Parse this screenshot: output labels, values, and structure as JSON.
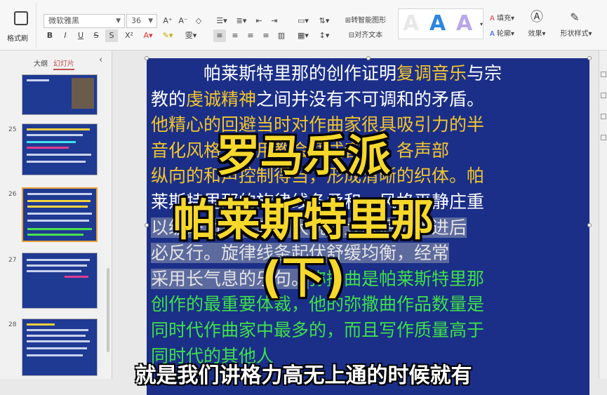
{
  "ribbon": {
    "format_painter_label": "格式刷",
    "font_name": "微软雅黑",
    "font_size": "36",
    "bold": "B",
    "italic": "I",
    "underline": "U",
    "strikethrough": "S",
    "shadow": "S",
    "superscript": "X²",
    "convert_smartart": "转智能图形",
    "text_direction": "文字方向",
    "align_text": "对齐文本",
    "fill": "填充",
    "outline": "轮廓",
    "effects": "效果",
    "shape_style": "形状样式",
    "wordart_letter": "A"
  },
  "panel": {
    "tab_outline": "大纲",
    "tab_slides": "幻灯片",
    "slide_numbers": [
      "25",
      "26",
      "27",
      "28"
    ]
  },
  "slide": {
    "line1_a": "帕莱斯特里那的创作证明",
    "line1_b": "复调音乐",
    "line1_c": "与宗",
    "line2_a": "教的",
    "line2_b": "虔诚精神",
    "line2_c": "之间并没有不可调和的矛盾。",
    "line3": "他精心的回避当时对作曲家很具吸引力的半",
    "line4": "音化风格，采用教会调式音阶，各声部",
    "line5": "纵向的和声控制得当，形成清晰的织体。帕",
    "line6": "莱斯特里那的旋律线条柔和，风格平静庄重",
    "line7": "以级进为主，较少大跳，大跳后的跳进后",
    "line8": "必反行。旋律线条起伏舒缓均衡，经常",
    "line9_a": "采用长气息的乐句。",
    "line9_b": "弥撒曲是帕莱斯特里那",
    "line10": "创作的最重要体裁，他的弥撒曲作品数量是",
    "line11": "同时代作曲家中最多的，而且写作质量高于",
    "line12": "同时代的其他人"
  },
  "overlay": {
    "title1": "罗马乐派",
    "title2": "帕莱斯特里那",
    "title3": "(下)"
  },
  "caption": "就是我们讲格力高无上通的时候就有",
  "colors": {
    "slide_bg": "#1b2f88",
    "highlight_yellow": "#f3c62c",
    "highlight_green": "#3ee04a",
    "overlay_yellow": "#f6d82c"
  }
}
